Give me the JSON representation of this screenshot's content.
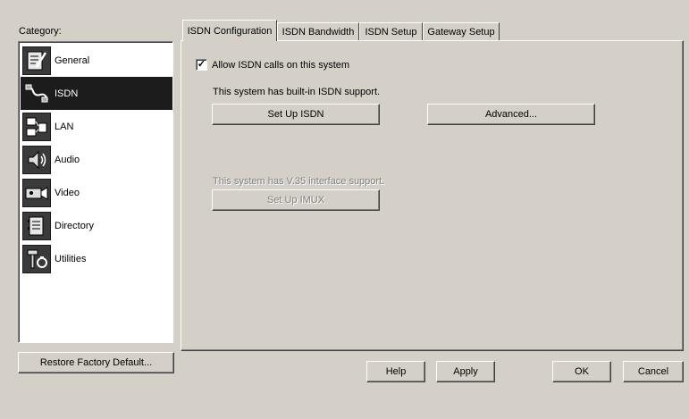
{
  "category": {
    "label": "Category:",
    "items": [
      {
        "label": "General",
        "icon": "general-icon"
      },
      {
        "label": "ISDN",
        "icon": "isdn-icon",
        "selected": true
      },
      {
        "label": "LAN",
        "icon": "lan-icon"
      },
      {
        "label": "Audio",
        "icon": "audio-icon"
      },
      {
        "label": "Video",
        "icon": "video-icon"
      },
      {
        "label": "Directory",
        "icon": "directory-icon"
      },
      {
        "label": "Utilities",
        "icon": "utilities-icon"
      }
    ]
  },
  "restore_button": "Restore Factory Default...",
  "tabs": [
    {
      "label": "ISDN Configuration",
      "active": true
    },
    {
      "label": "ISDN Bandwidth"
    },
    {
      "label": "ISDN Setup"
    },
    {
      "label": "Gateway Setup"
    }
  ],
  "isdn_config": {
    "allow_calls_label": "Allow ISDN calls on this system",
    "allow_calls_checked": true,
    "checkmark": "✓",
    "builtin_text": "This system has built-in ISDN support.",
    "setup_isdn_button": "Set Up ISDN",
    "advanced_button": "Advanced...",
    "v35_text": "This system has V.35 interface support.",
    "setup_imux_button": "Set Up IMUX"
  },
  "footer": {
    "help": "Help",
    "apply": "Apply",
    "ok": "OK",
    "cancel": "Cancel"
  },
  "colors": {
    "dialog_bg": "#d4d0c8",
    "selection_bg": "#1c1c1c",
    "disabled_text": "#808080"
  }
}
